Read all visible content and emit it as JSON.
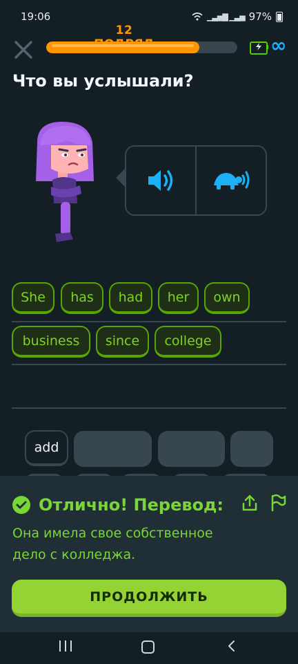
{
  "status": {
    "time": "19:06",
    "battery": "97%"
  },
  "header": {
    "streak": "12 ПОДРЯД",
    "progress_fraction": 0.8,
    "infinity": "∞"
  },
  "prompt": {
    "title": "Что вы услышали?"
  },
  "answer": {
    "words": [
      "She",
      "has",
      "had",
      "her",
      "own",
      "business",
      "since",
      "college"
    ]
  },
  "bank": {
    "visible_word": "add"
  },
  "feedback": {
    "title": "Отлично! Перевод:",
    "translation": "Она имела свое собственное дело с колледжа.",
    "continue_label": "ПРОДОЛЖИТЬ"
  },
  "colors": {
    "correct": "#79d634",
    "streak": "#ff9600",
    "accent_blue": "#1cb0f6",
    "button": "#93d333"
  }
}
